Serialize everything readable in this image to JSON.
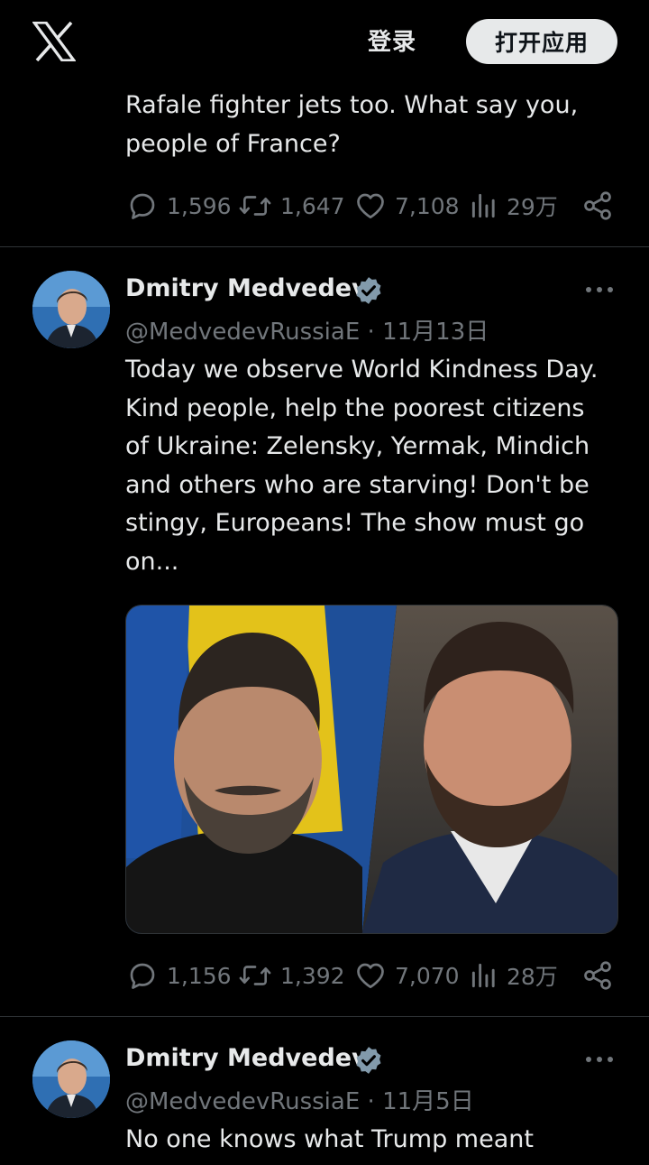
{
  "header": {
    "logo_icon": "x-logo-icon",
    "login_label": "登录",
    "open_app_label": "打开应用"
  },
  "tweets": [
    {
      "text": "Rafale fighter jets too. What say you,\npeople of France?",
      "replies": "1,596",
      "reposts": "1,647",
      "likes": "7,108",
      "views": "29万"
    },
    {
      "name": "Dmitry Medvedev",
      "handle": "@MedvedevRussiaE",
      "separator": "·",
      "date": "11月13日",
      "text": "Today we observe World Kindness Day.\nKind people, help the poorest citizens\nof Ukraine: Zelensky, Yermak, Mindich\nand others who are starving! Don't be\nstingy, Europeans! The show must go\non...",
      "replies": "1,156",
      "reposts": "1,392",
      "likes": "7,070",
      "views": "28万"
    },
    {
      "name": "Dmitry Medvedev",
      "handle": "@MedvedevRussiaE",
      "separator": "·",
      "date": "11月5日",
      "text": "No one knows what Trump meant"
    }
  ],
  "colors": {
    "background": "#000000",
    "text": "#e7e9ea",
    "muted": "#71767b",
    "divider": "#2f3336",
    "verified_badge": "#829aab"
  }
}
